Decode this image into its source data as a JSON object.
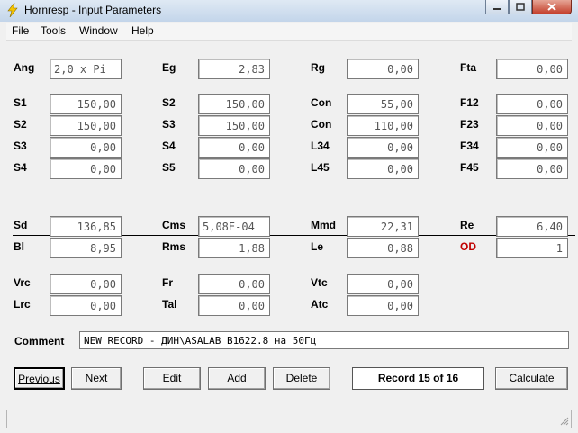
{
  "window": {
    "title": "Hornresp - Input Parameters"
  },
  "menu": [
    "File",
    "Tools",
    "Window",
    "Help"
  ],
  "row1": [
    {
      "label": "Ang",
      "value": "2,0 x Pi"
    },
    {
      "label": "Eg",
      "value": "2,83"
    },
    {
      "label": "Rg",
      "value": "0,00"
    },
    {
      "label": "Fta",
      "value": "0,00"
    }
  ],
  "block2": {
    "col1": [
      {
        "label": "S1",
        "value": "150,00"
      },
      {
        "label": "S2",
        "value": "150,00"
      },
      {
        "label": "S3",
        "value": "0,00"
      },
      {
        "label": "S4",
        "value": "0,00"
      }
    ],
    "col2": [
      {
        "label": "S2",
        "value": "150,00"
      },
      {
        "label": "S3",
        "value": "150,00"
      },
      {
        "label": "S4",
        "value": "0,00"
      },
      {
        "label": "S5",
        "value": "0,00"
      }
    ],
    "col3": [
      {
        "label": "Con",
        "value": "55,00"
      },
      {
        "label": "Con",
        "value": "110,00"
      },
      {
        "label": "L34",
        "value": "0,00"
      },
      {
        "label": "L45",
        "value": "0,00"
      }
    ],
    "col4": [
      {
        "label": "F12",
        "value": "0,00"
      },
      {
        "label": "F23",
        "value": "0,00"
      },
      {
        "label": "F34",
        "value": "0,00"
      },
      {
        "label": "F45",
        "value": "0,00"
      }
    ]
  },
  "driver": {
    "row1": [
      {
        "label": "Sd",
        "value": "136,85"
      },
      {
        "label": "Cms",
        "value": "5,08E-04"
      },
      {
        "label": "Mmd",
        "value": "22,31"
      },
      {
        "label": "Re",
        "value": "6,40"
      }
    ],
    "row2": [
      {
        "label": "Bl",
        "value": "8,95"
      },
      {
        "label": "Rms",
        "value": "1,88"
      },
      {
        "label": "Le",
        "value": "0,88"
      },
      {
        "label": "OD",
        "value": "1"
      }
    ]
  },
  "chamber": {
    "row1": [
      {
        "label": "Vrc",
        "value": "0,00"
      },
      {
        "label": "Fr",
        "value": "0,00"
      },
      {
        "label": "Vtc",
        "value": "0,00"
      }
    ],
    "row2": [
      {
        "label": "Lrc",
        "value": "0,00"
      },
      {
        "label": "Tal",
        "value": "0,00"
      },
      {
        "label": "Atc",
        "value": "0,00"
      }
    ]
  },
  "comment": {
    "label": "Comment",
    "value": "NEW RECORD - ДИН\\ASALAB B1622.8 на 50Гц"
  },
  "buttons": {
    "previous": "Previous",
    "next": "Next",
    "edit": "Edit",
    "add": "Add",
    "delete": "Delete",
    "calculate": "Calculate"
  },
  "record": "Record 15 of 16",
  "colors": {
    "accent_label": "#c00000",
    "titlebar": "#c3d5ea"
  }
}
